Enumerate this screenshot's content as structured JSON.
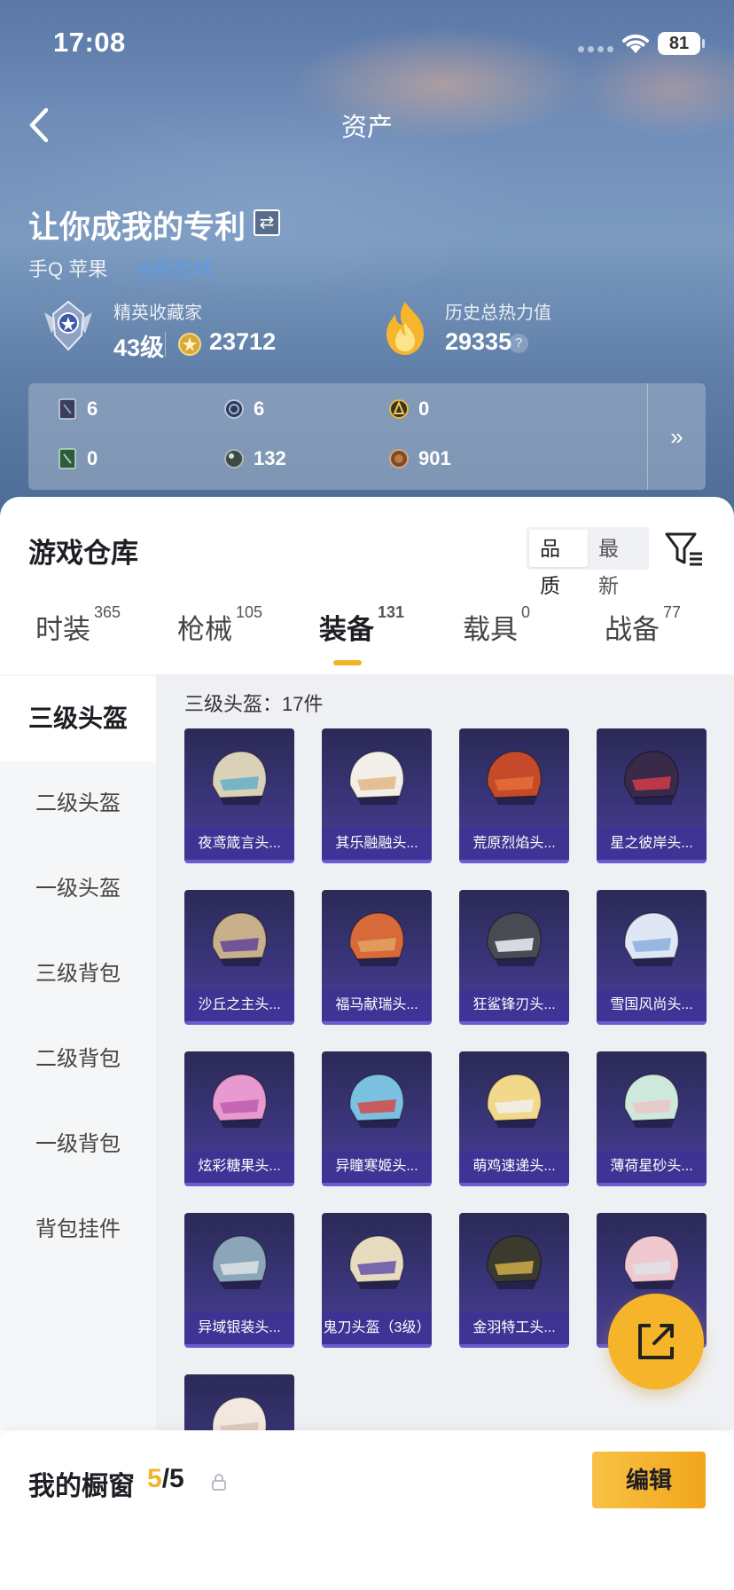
{
  "status_bar": {
    "time": "17:08",
    "battery": "81"
  },
  "header": {
    "title": "资产"
  },
  "profile": {
    "username": "让你成我的专利",
    "platform": "手Q 苹果",
    "online_status": "当前在线",
    "rank_label": "精英收藏家",
    "level": "43级",
    "coins": "23712",
    "heat_label": "历史总热力值",
    "heat_value": "29335"
  },
  "inventory": {
    "items": [
      {
        "icon": "card-icon",
        "value": "6"
      },
      {
        "icon": "medal-blue-icon",
        "value": "6"
      },
      {
        "icon": "gold-badge-icon",
        "value": "0"
      },
      {
        "icon": "green-card-icon",
        "value": "0"
      },
      {
        "icon": "orb-icon",
        "value": "132"
      },
      {
        "icon": "bronze-coin-icon",
        "value": "901"
      }
    ],
    "more": "»"
  },
  "warehouse": {
    "title": "游戏仓库",
    "sort_options": [
      "品质",
      "最新"
    ],
    "tabs": [
      {
        "label": "时装",
        "count": "365"
      },
      {
        "label": "枪械",
        "count": "105"
      },
      {
        "label": "装备",
        "count": "131"
      },
      {
        "label": "载具",
        "count": "0"
      },
      {
        "label": "战备",
        "count": "77"
      }
    ],
    "active_tab": "装备"
  },
  "categories": [
    "三级头盔",
    "二级头盔",
    "一级头盔",
    "三级背包",
    "二级背包",
    "一级背包",
    "背包挂件"
  ],
  "grid": {
    "caption": "三级头盔：17件",
    "items": [
      "夜鸢箴言头...",
      "其乐融融头...",
      "荒原烈焰头...",
      "星之彼岸头...",
      "沙丘之主头...",
      "福马献瑞头...",
      "狂鲨锋刃头...",
      "雪国风尚头...",
      "炫彩糖果头...",
      "异瞳寒姬头...",
      "萌鸡速递头...",
      "薄荷星砂头...",
      "异域银装头...",
      "鬼刀头盔（3级）",
      "金羽特工头...",
      "",
      ""
    ]
  },
  "showcase": {
    "label": "我的橱窗",
    "current": "5",
    "total": "/5",
    "edit_label": "编辑"
  },
  "colors": {
    "accent": "#f0b429",
    "card_bg": "#3a357a",
    "link": "#5a9be8"
  }
}
